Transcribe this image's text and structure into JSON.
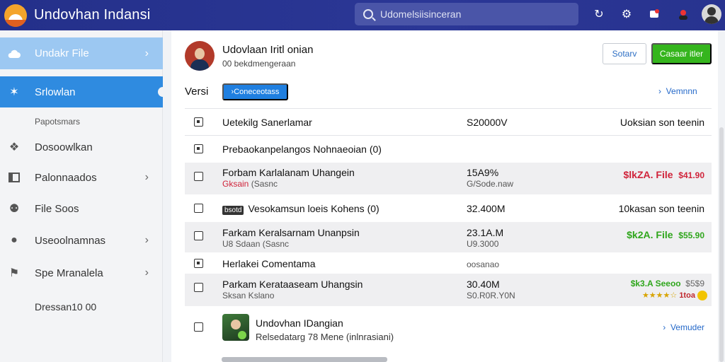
{
  "header": {
    "title": "Undovhan Indansi",
    "search_placeholder": "Udomelsiisinceran"
  },
  "sidebar": {
    "top_item": "Undakr File",
    "active_item": "Srlowlan",
    "section_label": "Papotsmars",
    "items": [
      {
        "label": "Dosoowlkan"
      },
      {
        "label": "Palonnaados"
      },
      {
        "label": "File Soos"
      },
      {
        "label": "Useoolnamnas"
      },
      {
        "label": "Spe Mranalela"
      }
    ],
    "footer": "Dressan10 00"
  },
  "profile": {
    "name": "Udovlaan Iritl onian",
    "subtitle": "00 bekdmengeraan",
    "btn_outline": "Sotarv",
    "btn_green": "Casaar itler"
  },
  "version": {
    "label": "Versi",
    "button": "Coneceotass",
    "link": "Vemnnn"
  },
  "rows": [
    {
      "main": "Uetekilg Sanerlamar",
      "mid": "S20000V",
      "right": "Uoksian son teenin"
    },
    {
      "main": "Prebaokanpelangos Nohnaeoian (0)"
    },
    {
      "main": "Forbam Karlalanam Uhangein",
      "sub_red": "Gksain",
      "sub": "(Sasnc",
      "mid": "15A9%",
      "mid_sub": "G/Sode.naw",
      "right": "$lkZA. File",
      "right_tail": "$41.90"
    },
    {
      "badge": "bsotd",
      "main": "Vesokamsun loeis Kohens (0)",
      "mid": "32.400M",
      "right": "10kasan son teenin"
    },
    {
      "main": "Farkam Keralsarnam Unanpsin",
      "sub": "U8 Sdaan (Sasnc",
      "mid": "23.1A.M",
      "mid_sub": "U9.3000",
      "right": "$k2A. File",
      "right_tail": "$55.90"
    },
    {
      "main": "Herlakei Comentama",
      "mid": "oosanao"
    },
    {
      "main": "Parkam Kerataaseam Uhangsin",
      "sub": "Sksan Kslano",
      "mid": "30.40M",
      "mid_sub": "S0.R0R.Y0N",
      "right": "$k3.A Seeoo",
      "right_tail": "$5$9",
      "stars": "★★★★☆",
      "rating": "1toa"
    },
    {
      "main": "Undovhan IDangian",
      "sub": "Relsedatarg 78 Mene (inlnrasiani)",
      "right": "Vemuder"
    }
  ],
  "colors": {
    "topbar": "#2b3796",
    "active": "#2f8be0",
    "green": "#35b51d",
    "red": "#d0233a"
  }
}
